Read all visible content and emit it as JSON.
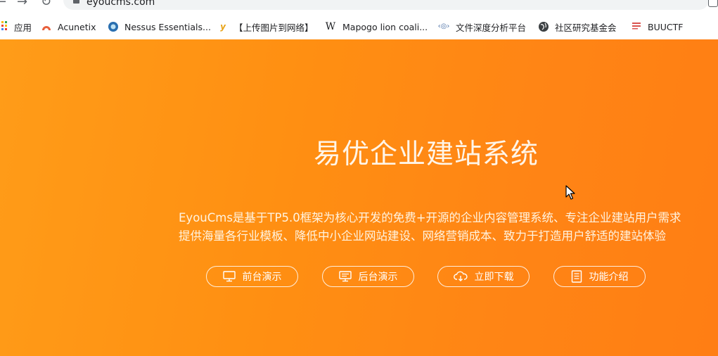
{
  "browser": {
    "url": "eyoucms.com"
  },
  "bookmarks": [
    {
      "icon": "apps-grid-icon",
      "label": "应用",
      "color": "#ea4335"
    },
    {
      "icon": "acunetix-icon",
      "label": "Acunetix",
      "color": "#e8603c"
    },
    {
      "icon": "nessus-icon",
      "label": "Nessus Essentials...",
      "color": "#2a6fb0"
    },
    {
      "icon": "y-logo-icon",
      "label": "【上传图片到网络】",
      "color": "#e8a317"
    },
    {
      "icon": "wikipedia-icon",
      "label": "Mapogo lion coali...",
      "color": "#202124"
    },
    {
      "icon": "code-icon",
      "label": "文件深度分析平台",
      "color": "#4a6fa5"
    },
    {
      "icon": "globe-icon",
      "label": "社区研究基金会",
      "color": "#3c4043"
    },
    {
      "icon": "flag-icon",
      "label": "BUUCTF",
      "color": "#d9534f"
    }
  ],
  "hero": {
    "title": "易优企业建站系统",
    "desc_line1": "EyouCms是基于TP5.0框架为核心开发的免费+开源的企业内容管理系统、专注企业建站用户需求",
    "desc_line2": "提供海量各行业模板、降低中小企业网站建设、网络营销成本、致力于打造用户舒适的建站体验",
    "buttons": [
      {
        "label": "前台演示",
        "icon": "monitor-icon"
      },
      {
        "label": "后台演示",
        "icon": "admin-screen-icon"
      },
      {
        "label": "立即下载",
        "icon": "cloud-download-icon"
      },
      {
        "label": "功能介绍",
        "icon": "document-list-icon"
      }
    ]
  },
  "colors": {
    "hero_start": "#ff9c18",
    "hero_end": "#ff7e14",
    "text": "#ffffff"
  }
}
